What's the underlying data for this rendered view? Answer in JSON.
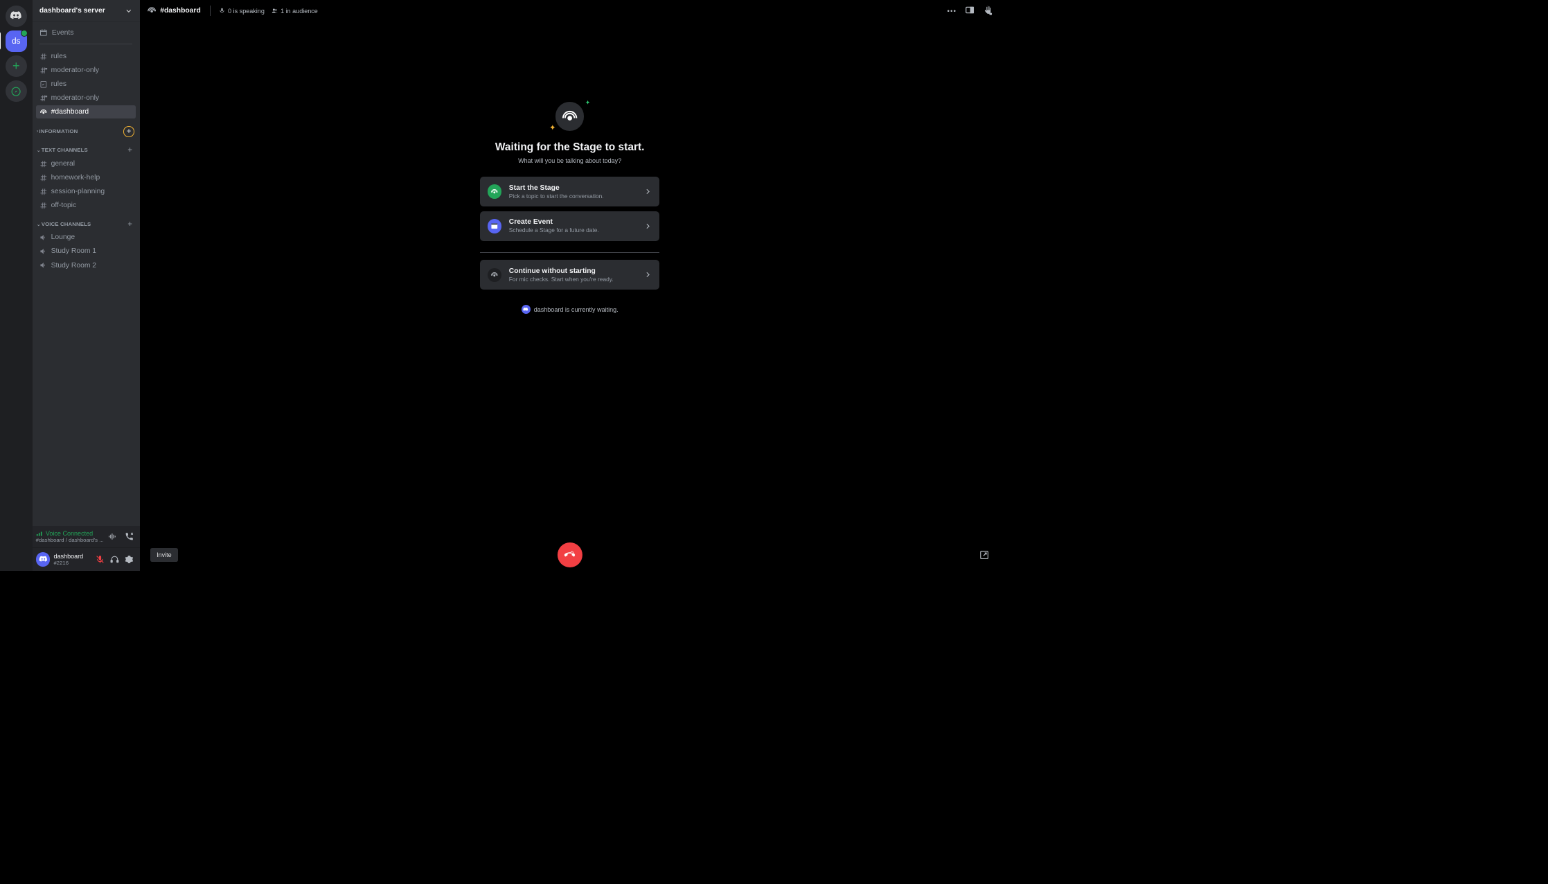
{
  "server": {
    "name": "dashboard's server",
    "abbrev": "ds"
  },
  "sidebar": {
    "events_label": "Events",
    "channels": [
      {
        "icon": "hash",
        "label": "rules",
        "arrow": false
      },
      {
        "icon": "hash-lock",
        "label": "moderator-only",
        "arrow": true
      },
      {
        "icon": "rules",
        "label": "rules",
        "arrow": false
      },
      {
        "icon": "hash-lock",
        "label": "moderator-only",
        "arrow": true
      },
      {
        "icon": "stage",
        "label": "#dashboard",
        "arrow": false,
        "selected": true
      }
    ],
    "categories": [
      {
        "name": "INFORMATION",
        "channels": [],
        "highlight_add": true
      },
      {
        "name": "TEXT CHANNELS",
        "channels": [
          {
            "icon": "hash",
            "label": "general"
          },
          {
            "icon": "hash",
            "label": "homework-help"
          },
          {
            "icon": "hash",
            "label": "session-planning"
          },
          {
            "icon": "hash",
            "label": "off-topic"
          }
        ]
      },
      {
        "name": "VOICE CHANNELS",
        "channels": [
          {
            "icon": "speaker",
            "label": "Lounge"
          },
          {
            "icon": "speaker",
            "label": "Study Room 1"
          },
          {
            "icon": "speaker",
            "label": "Study Room 2"
          }
        ]
      }
    ]
  },
  "voice": {
    "status": "Voice Connected",
    "sub": "#dashboard / dashboard's ..."
  },
  "user": {
    "name": "dashboard",
    "tag": "#2216"
  },
  "topbar": {
    "channel": "#dashboard",
    "speaking_count": "0 is speaking",
    "audience_count": "1 in audience"
  },
  "stage": {
    "heading": "Waiting for the Stage to start.",
    "sub": "What will you be talking about today?",
    "cards": {
      "start": {
        "title": "Start the Stage",
        "sub": "Pick a topic to start the conversation."
      },
      "event": {
        "title": "Create Event",
        "sub": "Schedule a Stage for a future date."
      },
      "continue": {
        "title": "Continue without starting",
        "sub": "For mic checks. Start when you're ready."
      }
    },
    "waiting": "dashboard is currently waiting."
  },
  "bottom": {
    "invite": "Invite"
  }
}
